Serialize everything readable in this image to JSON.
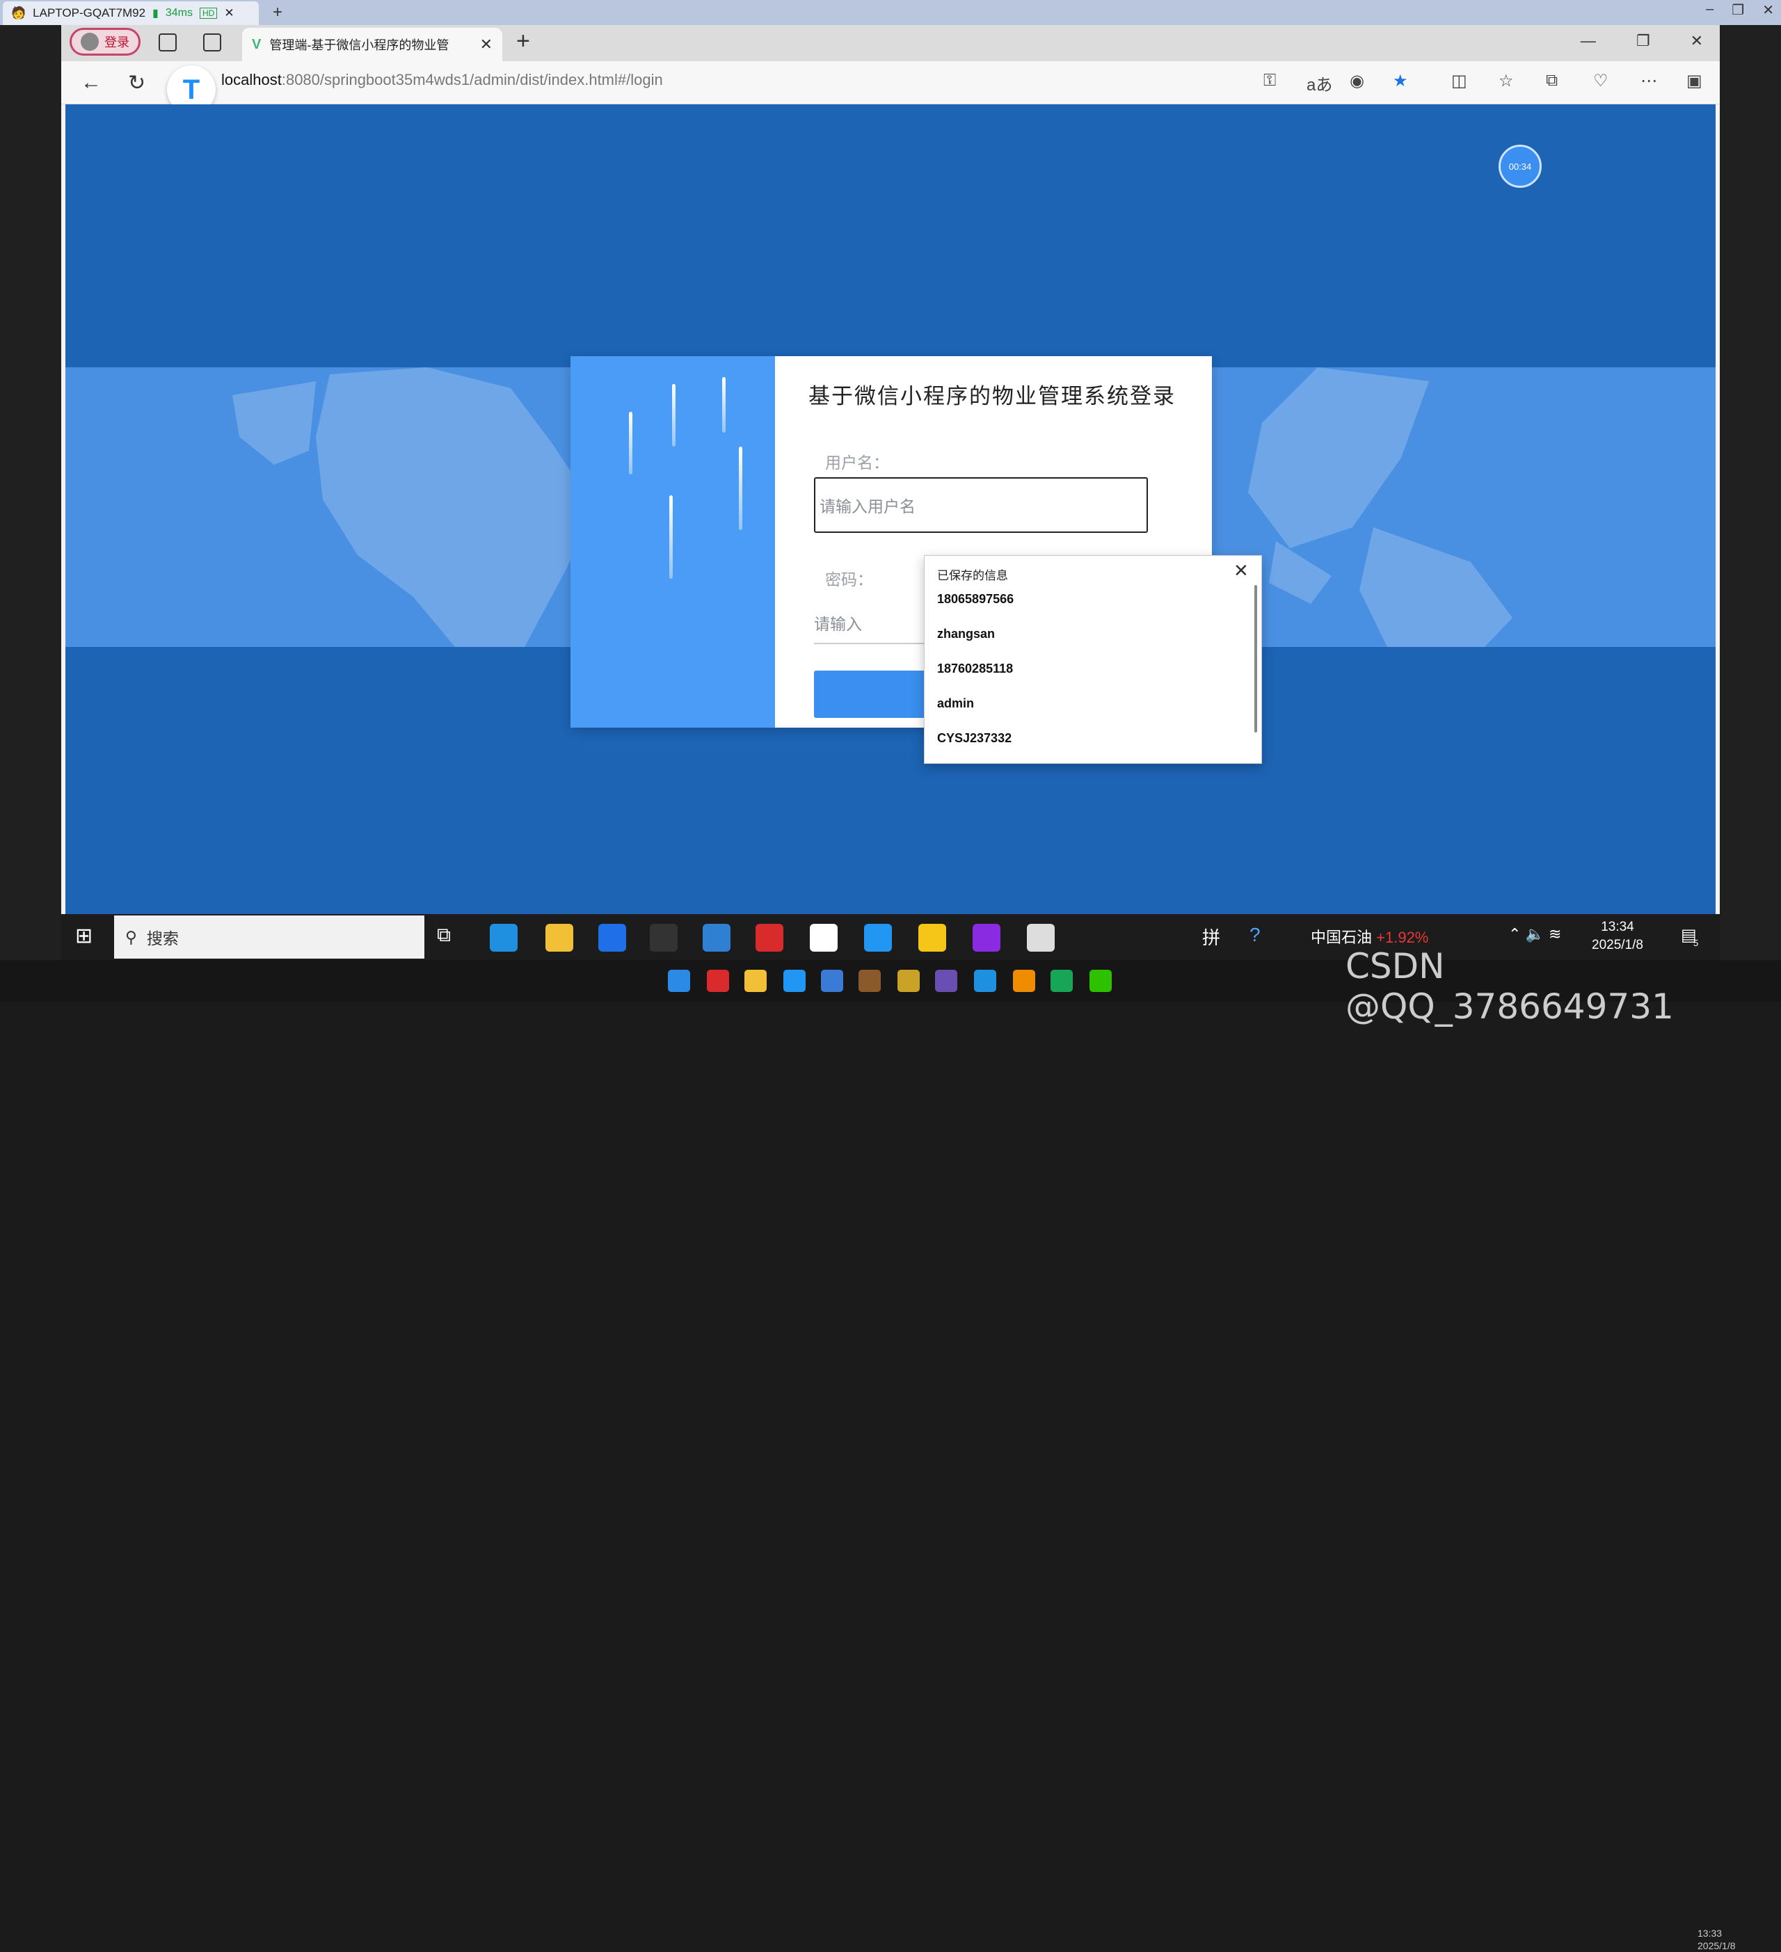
{
  "remote": {
    "host_label": "LAPTOP-GQAT7M92",
    "latency": "34ms",
    "quality_badge": "HD"
  },
  "browser": {
    "profile_label": "登录",
    "tab_title": "管理端-基于微信小程序的物业管",
    "url_host": "localhost",
    "url_path": ":8080/springboot35m4wds1/admin/dist/index.html#/login"
  },
  "page": {
    "timer": "00:34",
    "login": {
      "title": "基于微信小程序的物业管理系统登录",
      "username_label": "用户名：",
      "username_placeholder": "请输入用户名",
      "password_label": "密码：",
      "password_placeholder": "请输入"
    },
    "autofill": {
      "header": "已保存的信息",
      "items": [
        "18065897566",
        "zhangsan",
        "18760285118",
        "admin",
        "CYSJ237332"
      ]
    }
  },
  "taskbar": {
    "search_label": "搜索",
    "stock_name": "中国石油",
    "stock_change": "+1.92%",
    "time": "13:34",
    "date": "2025/1/8",
    "notif_count": "5"
  },
  "taskbar2": {
    "time": "13:33",
    "date": "2025/1/8"
  },
  "watermark": "CSDN @QQ_3786649731",
  "colors": {
    "page_bg": "#1d64b5",
    "band": "#4a90e2",
    "card_left": "#4b9cf7",
    "button": "#3a8ff0"
  }
}
